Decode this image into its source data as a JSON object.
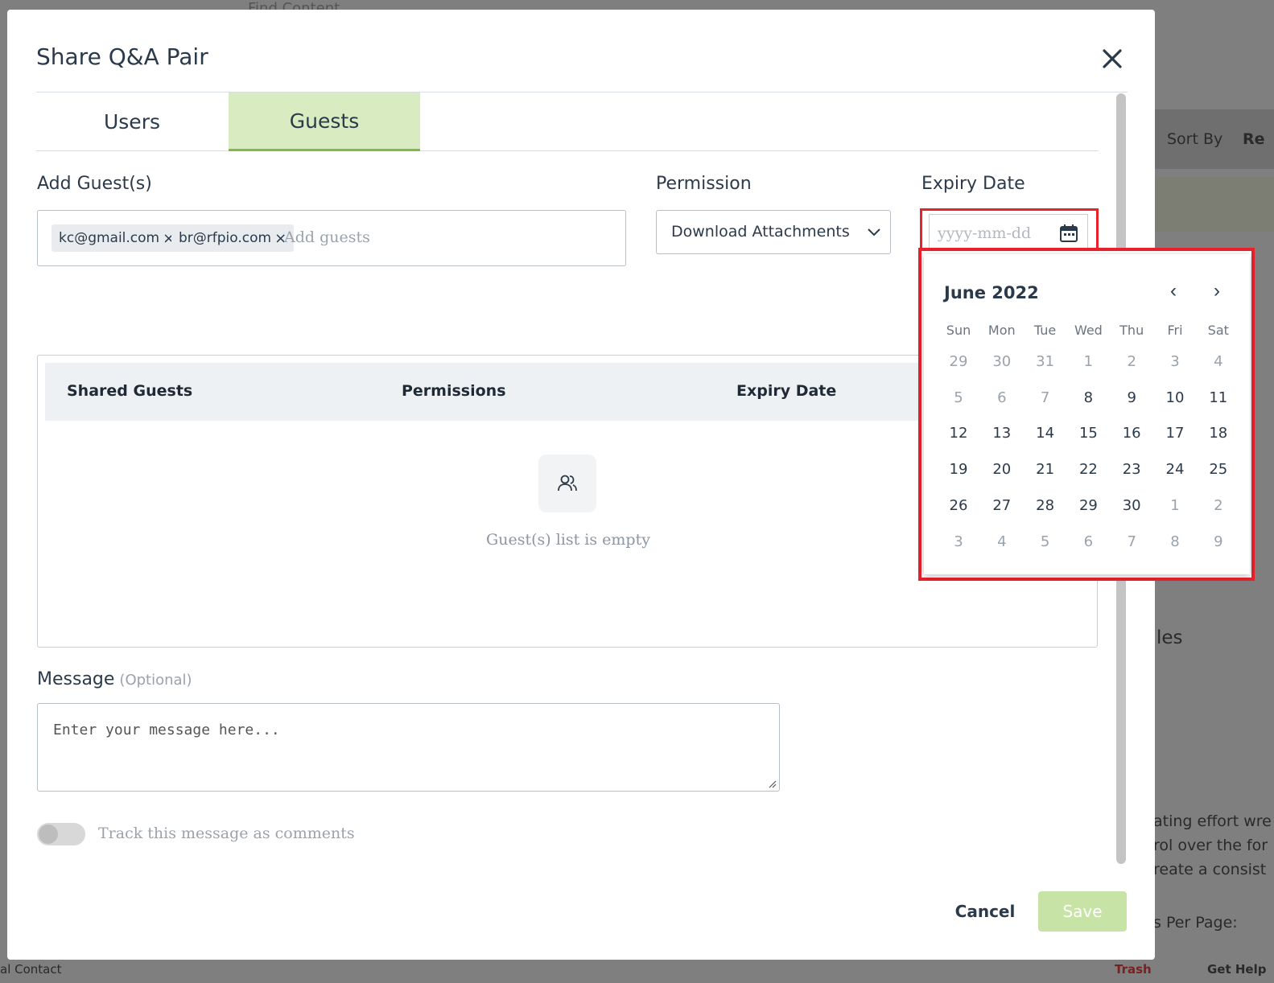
{
  "background": {
    "search_placeholder": "Find Content",
    "sort_by": "Sort By",
    "sort_value": "Re",
    "section_fragment": "les",
    "text_line1": "ating effort wre",
    "text_line2": "rol over the for",
    "text_line3": "reate a consist",
    "per_page": "s Per Page:",
    "footer_left": "al Contact",
    "trash": "Trash",
    "get_help": "Get Help"
  },
  "modal": {
    "title": "Share Q&A Pair",
    "tabs": [
      {
        "label": "Users",
        "active": false
      },
      {
        "label": "Guests",
        "active": true
      }
    ],
    "add_guests_label": "Add Guest(s)",
    "guest_chips": [
      "kc@gmail.com",
      "br@rfpio.com"
    ],
    "add_guests_placeholder": "Add guests",
    "permission_label": "Permission",
    "permission_value": "Download Attachments",
    "expiry_label": "Expiry Date",
    "expiry_placeholder": "yyyy-mm-dd",
    "table": {
      "headers": [
        "Shared Guests",
        "Permissions",
        "Expiry Date"
      ],
      "empty_text": "Guest(s) list is empty"
    },
    "message_label": "Message",
    "message_optional": "(Optional)",
    "message_placeholder": "Enter your message here...",
    "toggle_label": "Track this message as comments",
    "toggle_on": false,
    "cancel_label": "Cancel",
    "save_label": "Save"
  },
  "calendar": {
    "month_label": "June 2022",
    "prev": "‹",
    "next": "›",
    "weekdays": [
      "Sun",
      "Mon",
      "Tue",
      "Wed",
      "Thu",
      "Fri",
      "Sat"
    ],
    "weeks": [
      [
        {
          "d": "29",
          "m": true
        },
        {
          "d": "30",
          "m": true
        },
        {
          "d": "31",
          "m": true
        },
        {
          "d": "1",
          "m": true
        },
        {
          "d": "2",
          "m": true
        },
        {
          "d": "3",
          "m": true
        },
        {
          "d": "4",
          "m": true
        }
      ],
      [
        {
          "d": "5",
          "m": true
        },
        {
          "d": "6",
          "m": true
        },
        {
          "d": "7",
          "m": true
        },
        {
          "d": "8",
          "m": false
        },
        {
          "d": "9",
          "m": false
        },
        {
          "d": "10",
          "m": false
        },
        {
          "d": "11",
          "m": false
        }
      ],
      [
        {
          "d": "12",
          "m": false
        },
        {
          "d": "13",
          "m": false
        },
        {
          "d": "14",
          "m": false
        },
        {
          "d": "15",
          "m": false
        },
        {
          "d": "16",
          "m": false
        },
        {
          "d": "17",
          "m": false
        },
        {
          "d": "18",
          "m": false
        }
      ],
      [
        {
          "d": "19",
          "m": false
        },
        {
          "d": "20",
          "m": false
        },
        {
          "d": "21",
          "m": false
        },
        {
          "d": "22",
          "m": false
        },
        {
          "d": "23",
          "m": false
        },
        {
          "d": "24",
          "m": false
        },
        {
          "d": "25",
          "m": false
        }
      ],
      [
        {
          "d": "26",
          "m": false
        },
        {
          "d": "27",
          "m": false
        },
        {
          "d": "28",
          "m": false
        },
        {
          "d": "29",
          "m": false
        },
        {
          "d": "30",
          "m": false
        },
        {
          "d": "1",
          "m": true
        },
        {
          "d": "2",
          "m": true
        }
      ],
      [
        {
          "d": "3",
          "m": true
        },
        {
          "d": "4",
          "m": true
        },
        {
          "d": "5",
          "m": true
        },
        {
          "d": "6",
          "m": true
        },
        {
          "d": "7",
          "m": true
        },
        {
          "d": "8",
          "m": true
        },
        {
          "d": "9",
          "m": true
        }
      ]
    ]
  },
  "colors": {
    "highlight": "#e8212b",
    "tab_active_bg": "#d8ebc1",
    "tab_active_border": "#7fb94a",
    "save_bg": "#c7e3a6"
  }
}
